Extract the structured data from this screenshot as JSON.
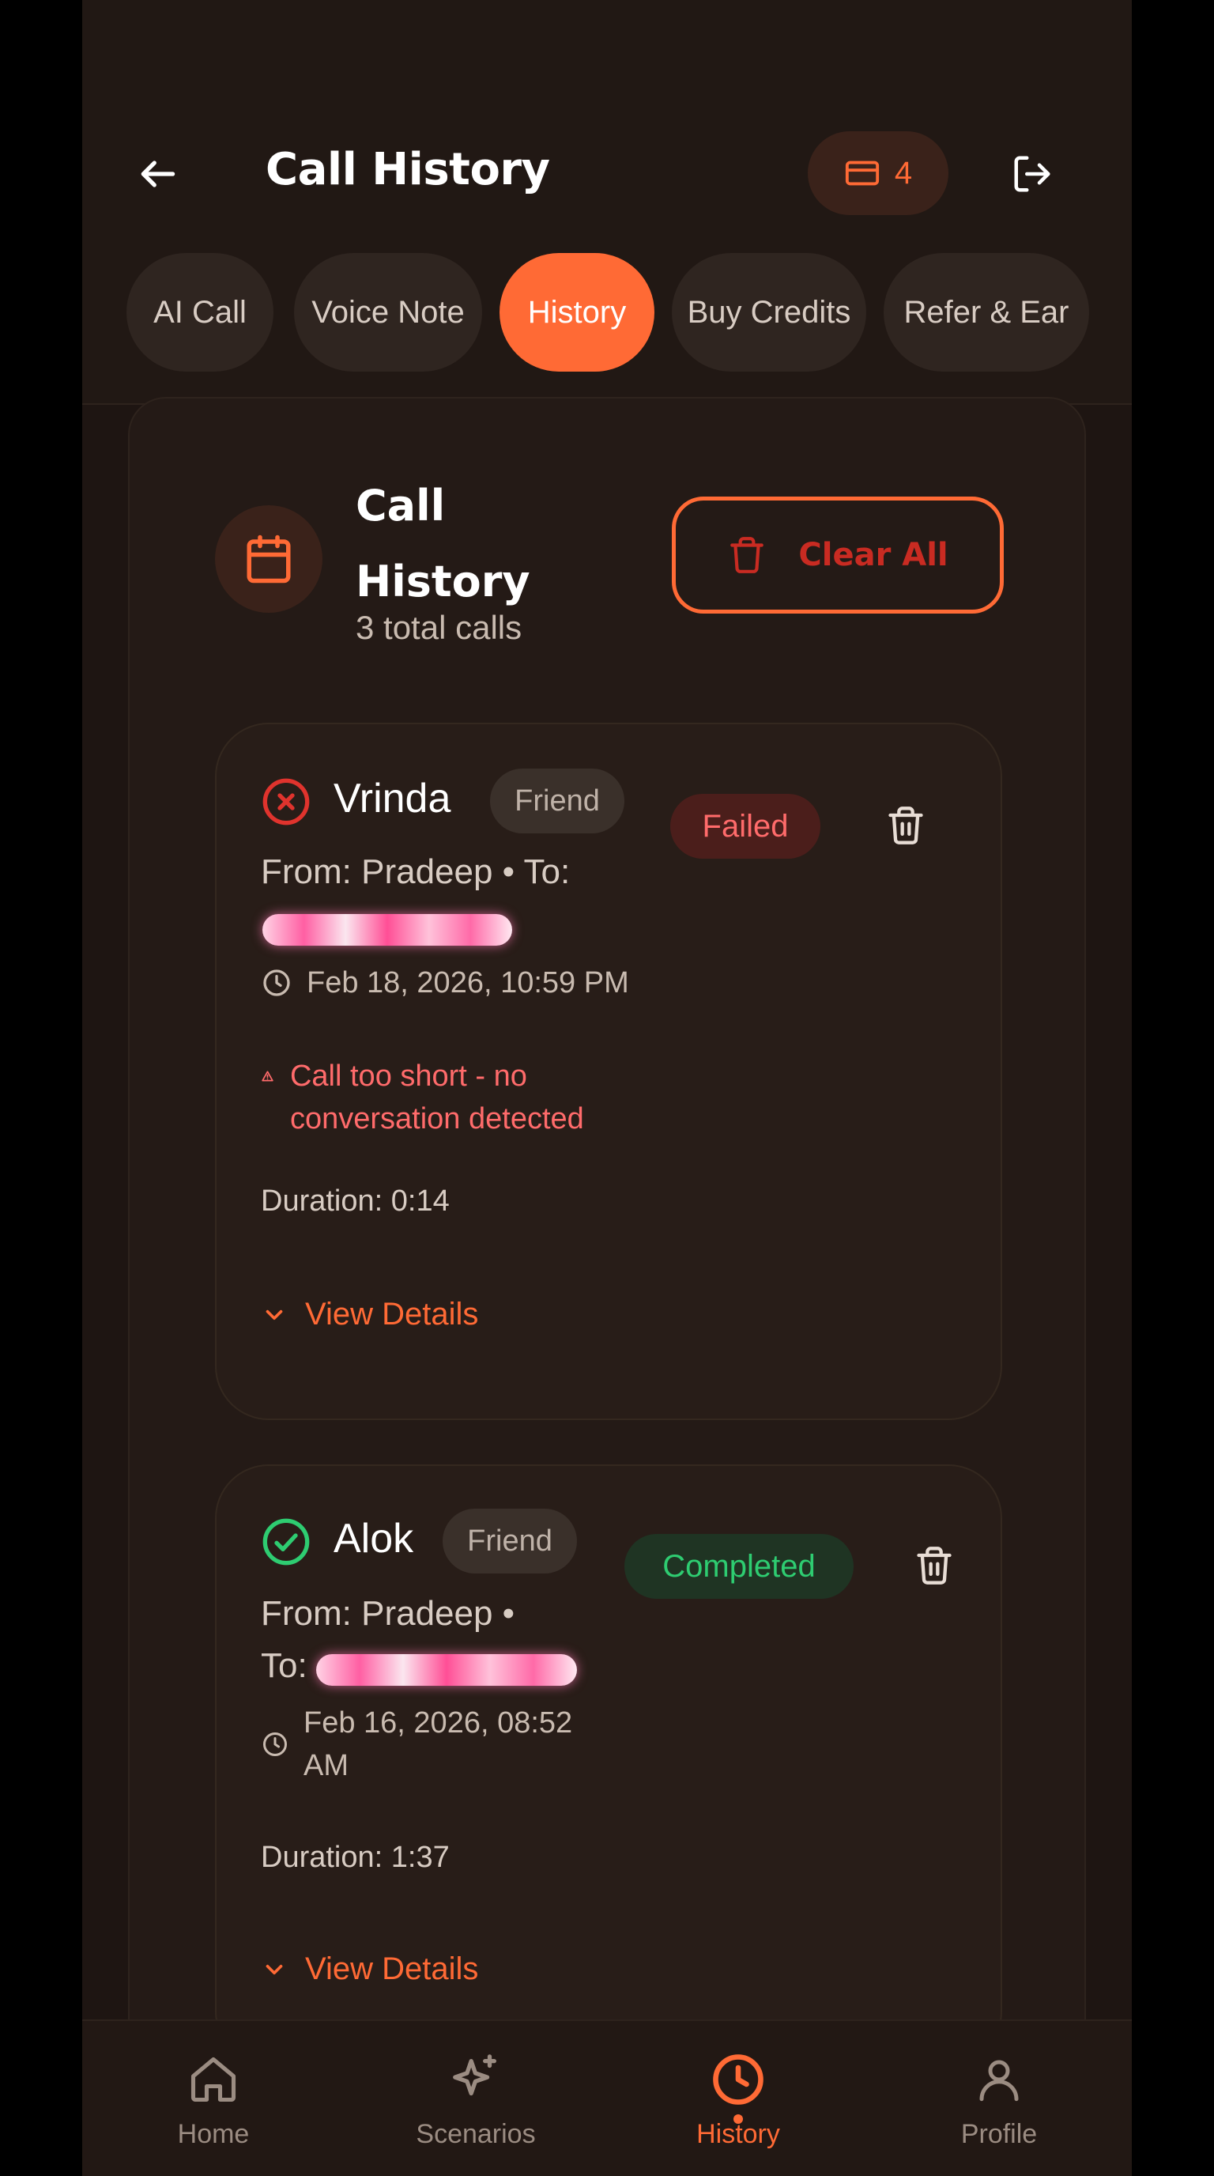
{
  "header": {
    "title": "Call History",
    "credits": "4",
    "back_icon": "arrow-left-icon",
    "logout_icon": "logout-icon"
  },
  "tabs": [
    {
      "label": "AI Call",
      "active": false
    },
    {
      "label": "Voice Note",
      "active": false
    },
    {
      "label": "History",
      "active": true
    },
    {
      "label": "Buy Credits",
      "active": false
    },
    {
      "label": "Refer & Ear",
      "active": false
    }
  ],
  "section": {
    "title_line1": "Call",
    "title_line2": "History",
    "subtitle": "3 total calls",
    "clear_all_label": "Clear All"
  },
  "calls": [
    {
      "name": "Vrinda",
      "relation": "Friend",
      "status": "Failed",
      "from_line": "From: Pradeep • To:",
      "timestamp": "Feb 18, 2026, 10:59 PM",
      "warning": "Call too short - no conversation detected",
      "duration": "Duration: 0:14",
      "view_details": "View Details"
    },
    {
      "name": "Alok",
      "relation": "Friend",
      "status": "Completed",
      "from_line": "From: Pradeep •",
      "to_label": "To:",
      "timestamp_line1": "Feb 16, 2026, 08:52",
      "timestamp_line2": "AM",
      "duration": "Duration: 1:37",
      "view_details": "View Details"
    }
  ],
  "bottom_nav": [
    {
      "label": "Home",
      "icon": "home-icon",
      "active": false
    },
    {
      "label": "Scenarios",
      "icon": "sparkles-icon",
      "active": false
    },
    {
      "label": "History",
      "icon": "clock-icon",
      "active": true
    },
    {
      "label": "Profile",
      "icon": "user-icon",
      "active": false
    }
  ],
  "colors": {
    "accent": "#ff6a35",
    "failed": "#ff6b6b",
    "completed": "#2ecc71",
    "background": "#1e1512"
  }
}
